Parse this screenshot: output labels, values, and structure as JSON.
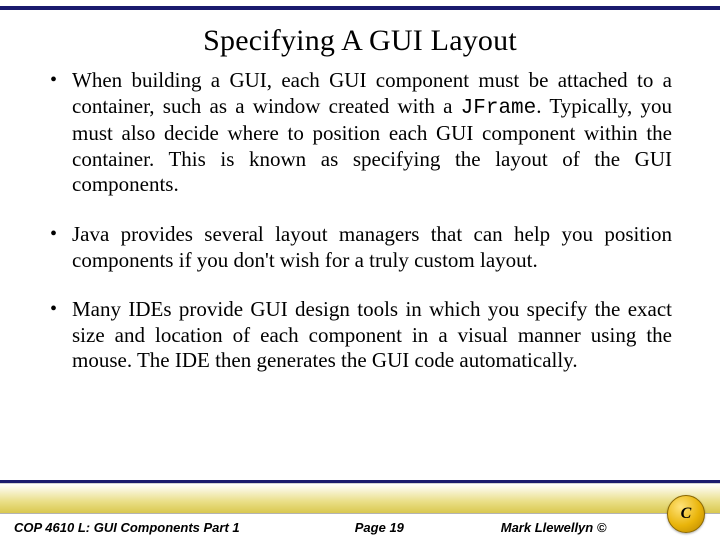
{
  "title": "Specifying A GUI Layout",
  "bullets": [
    {
      "pre": "When building a GUI, each GUI component must be attached to a container, such as a window created with a ",
      "code": "JFrame",
      "post": ".  Typically, you must also decide where to position each GUI component within the container.  This is known as specifying the layout of the GUI components."
    },
    {
      "pre": "Java provides several layout managers that can help you position components if you don't wish for a truly custom layout.",
      "code": "",
      "post": ""
    },
    {
      "pre": "Many IDEs provide GUI design tools in which you specify the exact size and location of each component in a visual manner using the mouse.  The IDE then generates the GUI code automatically.",
      "code": "",
      "post": ""
    }
  ],
  "footer": {
    "left": "COP 4610 L: GUI Components Part 1",
    "mid": "Page 19",
    "right": "Mark Llewellyn ©",
    "logo_letter": "C"
  }
}
